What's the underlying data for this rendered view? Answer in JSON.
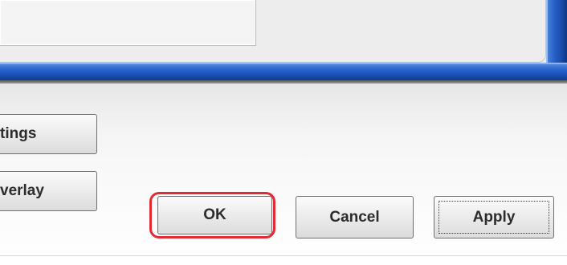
{
  "dialog": {
    "side_buttons": {
      "settings_label": "tings",
      "overlay_label": "verlay"
    },
    "buttons": {
      "ok_label": "OK",
      "cancel_label": "Cancel",
      "apply_label": "Apply"
    },
    "highlight": {
      "target": "ok-button",
      "color": "#e32b35"
    }
  },
  "colors": {
    "frame_blue": "#2660c8",
    "panel_grey": "#ededed"
  }
}
